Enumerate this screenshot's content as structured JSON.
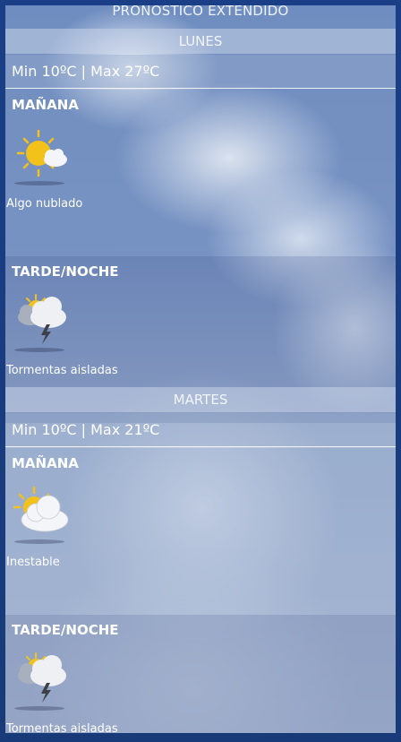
{
  "header": {
    "title": "PRONOSTICO EXTENDIDO"
  },
  "days": [
    {
      "name": "LUNES",
      "minmax": "Min 10ºC | Max 27ºC",
      "morning": {
        "label": "MAÑANA",
        "icon": "sun-cloud-icon",
        "desc": "Algo nublado"
      },
      "night": {
        "label": "TARDE/NOCHE",
        "icon": "storm-icon",
        "desc": "Tormentas aisladas"
      }
    },
    {
      "name": "MARTES",
      "minmax": "Min 10ºC | Max 21ºC",
      "morning": {
        "label": "MAÑANA",
        "icon": "cloudy-sun-icon",
        "desc": "Inestable"
      },
      "night": {
        "label": "TARDE/NOCHE",
        "icon": "storm-icon",
        "desc": "Tormentas aisladas"
      }
    }
  ],
  "colors": {
    "frame": "#1a3f86",
    "sun": "#f2c21a",
    "text": "#ffffff"
  }
}
